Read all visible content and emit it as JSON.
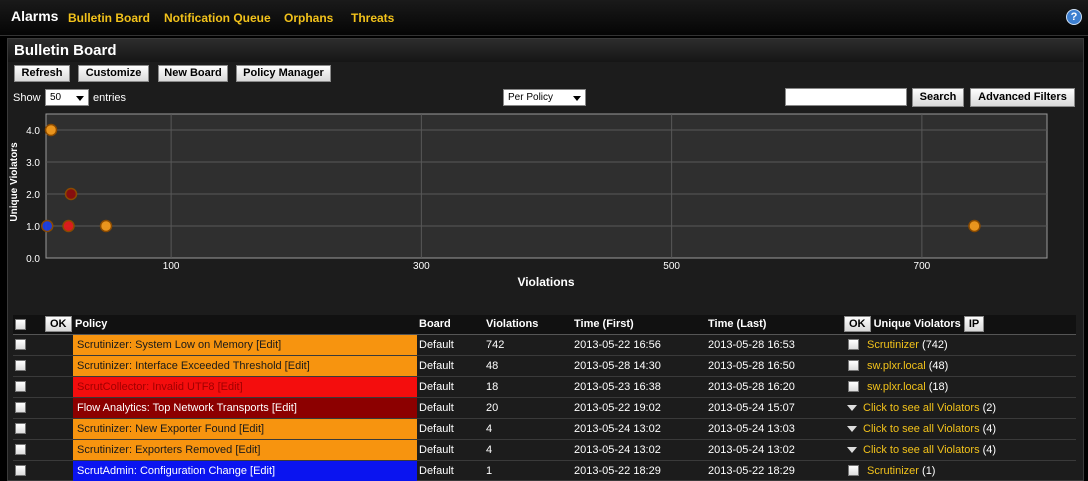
{
  "topbar": {
    "title": "Alarms",
    "nav": [
      "Bulletin Board",
      "Notification Queue",
      "Orphans",
      "Threats"
    ],
    "help_icon": "?"
  },
  "panel": {
    "title": "Bulletin Board",
    "buttons": {
      "refresh": "Refresh",
      "customize": "Customize",
      "new_board": "New Board",
      "policy_manager": "Policy Manager"
    },
    "show_label": "Show",
    "entries_label": "entries",
    "show_value": "50",
    "group_value": "Per Policy",
    "search_value": "",
    "search_label": "Search",
    "advanced_label": "Advanced Filters"
  },
  "chart_data": {
    "type": "scatter",
    "xlabel": "Violations",
    "ylabel": "Unique Violators",
    "x_ticks": [
      "100",
      "300",
      "500",
      "700"
    ],
    "y_ticks": [
      "0.0",
      "1.0",
      "2.0",
      "3.0",
      "4.0"
    ],
    "xlim": [
      0,
      800
    ],
    "ylim": [
      0,
      4.5
    ],
    "grid": true,
    "points": [
      {
        "x": 742,
        "y": 1,
        "color": "#f39a1c"
      },
      {
        "x": 48,
        "y": 1,
        "color": "#f39a1c"
      },
      {
        "x": 18,
        "y": 1,
        "color": "#e41b1b"
      },
      {
        "x": 20,
        "y": 2,
        "color": "#8b0d0d"
      },
      {
        "x": 4,
        "y": 4,
        "color": "#f39a1c"
      },
      {
        "x": 1,
        "y": 1,
        "color": "#1e3fe0"
      }
    ]
  },
  "table": {
    "ok_label": "OK",
    "ip_label": "IP",
    "headers": {
      "policy": "Policy",
      "board": "Board",
      "violations": "Violations",
      "time_first": "Time (First)",
      "time_last": "Time (Last)",
      "unique": "Unique Violators"
    },
    "rows": [
      {
        "policy": "Scrutinizer: System Low on Memory [Edit]",
        "bg": "#f7940f",
        "fg": "#1a1a1a",
        "board": "Default",
        "violations": "742",
        "first": "2013-05-22 16:56",
        "last": "2013-05-28 16:53",
        "expand": false,
        "violator": "Scrutinizer",
        "count": "(742)"
      },
      {
        "policy": "Scrutinizer: Interface Exceeded Threshold [Edit]",
        "bg": "#f7940f",
        "fg": "#1a1a1a",
        "board": "Default",
        "violations": "48",
        "first": "2013-05-28 14:30",
        "last": "2013-05-28 16:50",
        "expand": false,
        "violator": "sw.plxr.local",
        "count": "(48)"
      },
      {
        "policy": "ScrutCollector: Invalid UTF8 [Edit]",
        "bg": "#f40d0d",
        "fg": "#a10000",
        "board": "Default",
        "violations": "18",
        "first": "2013-05-23 16:38",
        "last": "2013-05-28 16:20",
        "expand": false,
        "violator": "sw.plxr.local",
        "count": "(18)"
      },
      {
        "policy": "Flow Analytics: Top Network Transports [Edit]",
        "bg": "#8c0000",
        "fg": "#ffffff",
        "board": "Default",
        "violations": "20",
        "first": "2013-05-22 19:02",
        "last": "2013-05-24 15:07",
        "expand": true,
        "violator": "Click to see all Violators",
        "count": "(2)"
      },
      {
        "policy": "Scrutinizer: New Exporter Found [Edit]",
        "bg": "#f7940f",
        "fg": "#1a1a1a",
        "board": "Default",
        "violations": "4",
        "first": "2013-05-24 13:02",
        "last": "2013-05-24 13:03",
        "expand": true,
        "violator": "Click to see all Violators",
        "count": "(4)"
      },
      {
        "policy": "Scrutinizer: Exporters Removed [Edit]",
        "bg": "#f7940f",
        "fg": "#1a1a1a",
        "board": "Default",
        "violations": "4",
        "first": "2013-05-24 13:02",
        "last": "2013-05-24 13:02",
        "expand": true,
        "violator": "Click to see all Violators",
        "count": "(4)"
      },
      {
        "policy": "ScrutAdmin: Configuration Change [Edit]",
        "bg": "#0a14f0",
        "fg": "#ffffff",
        "board": "Default",
        "violations": "1",
        "first": "2013-05-22 18:29",
        "last": "2013-05-22 18:29",
        "expand": false,
        "violator": "Scrutinizer",
        "count": "(1)"
      }
    ]
  }
}
